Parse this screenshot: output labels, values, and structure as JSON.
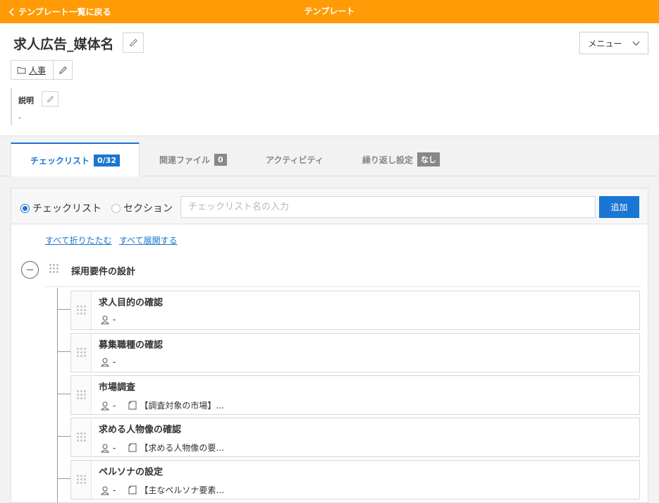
{
  "header": {
    "back_label": "テンプレート一覧に戻る",
    "title": "テンプレート"
  },
  "template": {
    "name": "求人広告_媒体名",
    "menu_label": "メニュー",
    "folder": "人事",
    "description_label": "説明",
    "description_value": "-"
  },
  "tabs": [
    {
      "label": "チェックリスト",
      "badge": "0/32",
      "active": true
    },
    {
      "label": "関連ファイル",
      "badge": "0",
      "active": false
    },
    {
      "label": "アクティビティ",
      "badge": "",
      "active": false
    },
    {
      "label": "繰り返し設定",
      "badge": "なし",
      "active": false
    }
  ],
  "add_form": {
    "radio_checklist": "チェックリスト",
    "radio_section": "セクション",
    "selected": "checklist",
    "input_placeholder": "チェックリスト名の入力",
    "input_value": "",
    "add_label": "追加"
  },
  "links": {
    "collapse_all": "すべて折りたたむ",
    "expand_all": "すべて展開する"
  },
  "section": {
    "title": "採用要件の設計",
    "items": [
      {
        "title": "求人目的の確認",
        "assignee": "-",
        "note": ""
      },
      {
        "title": "募集職種の確認",
        "assignee": "-",
        "note": ""
      },
      {
        "title": "市場調査",
        "assignee": "-",
        "note": "【調査対象の市場】…"
      },
      {
        "title": "求める人物像の確認",
        "assignee": "-",
        "note": "【求める人物像の要…"
      },
      {
        "title": "ペルソナの設定",
        "assignee": "-",
        "note": "【主なペルソナ要素…"
      }
    ]
  },
  "colors": {
    "header_bg": "#ff9b06",
    "accent": "#1976d2",
    "badge_gray": "#888888"
  }
}
